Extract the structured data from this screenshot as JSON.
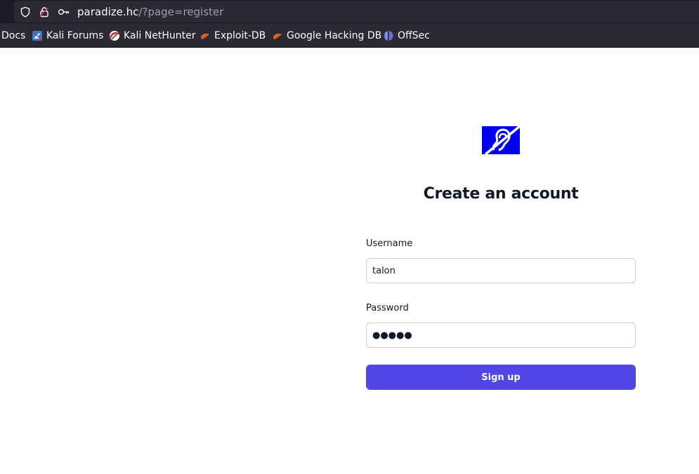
{
  "browser": {
    "url_host": "paradize.hc",
    "url_path": "/?page=register",
    "icons": [
      "shield-icon",
      "insecure-lock-icon",
      "key-icon"
    ]
  },
  "bookmarks": [
    {
      "label": "Docs",
      "icon": null
    },
    {
      "label": "Kali Forums",
      "icon": "kali-forums-icon"
    },
    {
      "label": "Kali NetHunter",
      "icon": "kali-nethunter-icon"
    },
    {
      "label": "Exploit-DB",
      "icon": "exploit-db-icon"
    },
    {
      "label": "Google Hacking DB",
      "icon": "ghdb-icon"
    },
    {
      "label": "OffSec",
      "icon": "offsec-icon"
    }
  ],
  "register": {
    "logo_icon": "hearing-accessibility-icon",
    "title": "Create an account",
    "username_label": "Username",
    "username_value": "talon",
    "password_label": "Password",
    "password_value": "●●●●●",
    "signup_label": "Sign up"
  },
  "colors": {
    "accent": "#4f46e5",
    "logo_bg": "#0000ee"
  }
}
